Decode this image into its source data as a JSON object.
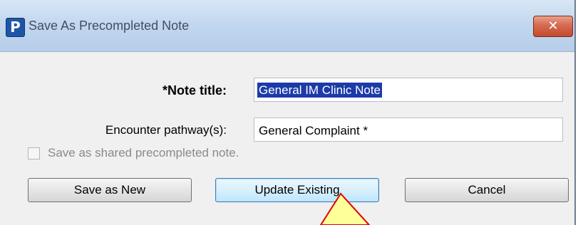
{
  "window": {
    "title": "Save As Precompleted Note",
    "app_icon_letter": "P",
    "close_glyph": "✕"
  },
  "form": {
    "note_title_label": "*Note title:",
    "note_title_value": "General IM Clinic Note",
    "pathway_label": "Encounter pathway(s):",
    "pathway_value": "General Complaint *",
    "shared_checkbox_label": "Save as shared precompleted note.",
    "shared_checkbox_checked": false,
    "shared_checkbox_enabled": false
  },
  "buttons": {
    "save_new": "Save as New",
    "update_existing": "Update Existing",
    "cancel": "Cancel"
  },
  "colors": {
    "title_selection": "#1c3aa8",
    "close_button": "#c34b2f",
    "cursor_fill": "#ffff99",
    "cursor_stroke": "#e00000"
  },
  "cursor": {
    "type": "arrow-pointer",
    "hovering": "update_existing"
  }
}
